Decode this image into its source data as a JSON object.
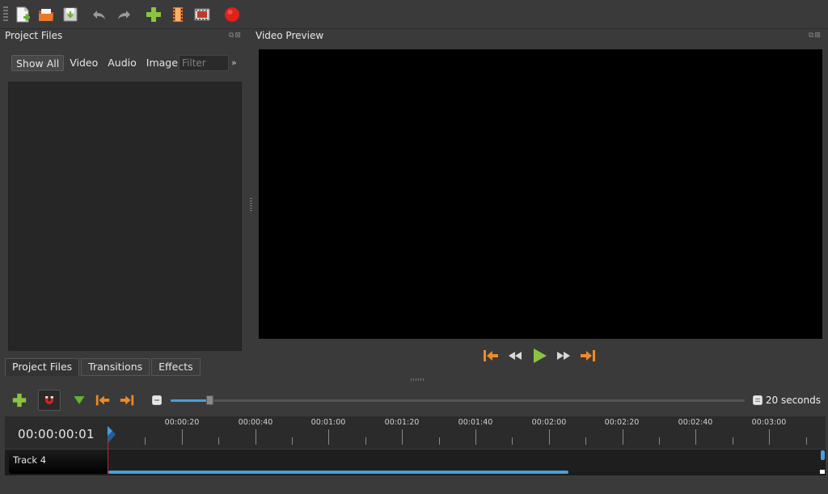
{
  "toolbar": {
    "icons": [
      "new-project-icon",
      "open-project-icon",
      "save-project-icon",
      "undo-icon",
      "redo-icon",
      "import-files-icon",
      "choose-profile-icon",
      "export-video-icon",
      "record-icon"
    ]
  },
  "project_files": {
    "title": "Project Files",
    "filter_tabs": [
      "Show All",
      "Video",
      "Audio",
      "Image"
    ],
    "filter_placeholder": "Filter",
    "more": "»"
  },
  "bottom_tabs": [
    "Project Files",
    "Transitions",
    "Effects"
  ],
  "video_preview": {
    "title": "Video Preview"
  },
  "timeline": {
    "zoom_label": "20 seconds",
    "timecode": "00:00:00:01",
    "time_labels": [
      "00:00:20",
      "00:00:40",
      "00:01:00",
      "00:01:20",
      "00:01:40",
      "00:02:00",
      "00:02:20",
      "00:02:40",
      "00:03:00"
    ],
    "track_name": "Track 4"
  },
  "colors": {
    "accent": "#4a9fd8",
    "playhead": "#c1272d",
    "play_green": "#8bc43f",
    "nav_orange": "#f08a24"
  }
}
